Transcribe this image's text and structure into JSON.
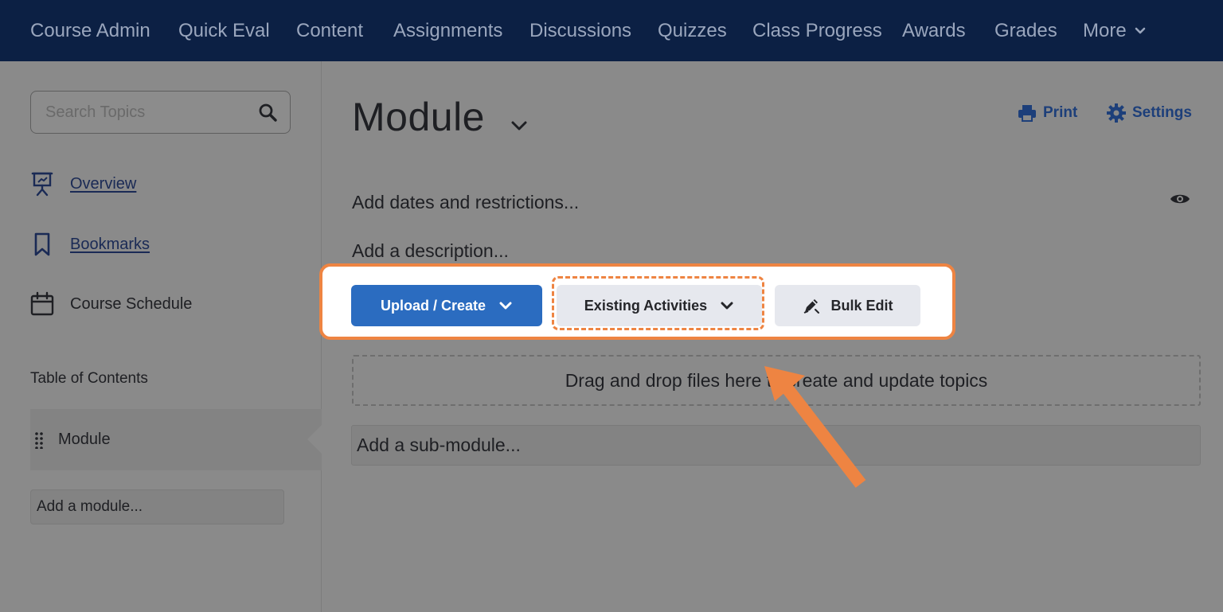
{
  "nav": {
    "items": [
      "Course Admin",
      "Quick Eval",
      "Content",
      "Assignments",
      "Discussions",
      "Quizzes",
      "Class Progress",
      "Awards",
      "Grades"
    ],
    "more_label": "More"
  },
  "sidebar": {
    "search": {
      "placeholder": "Search Topics",
      "value": ""
    },
    "links": {
      "overview": "Overview",
      "bookmarks": "Bookmarks",
      "schedule": "Course Schedule"
    },
    "toc_heading": "Table of Contents",
    "toc_module": "Module",
    "add_module": "Add a module..."
  },
  "main": {
    "title": "Module",
    "print_label": "Print",
    "settings_label": "Settings",
    "dates_text": "Add dates and restrictions...",
    "description_text": "Add a description...",
    "buttons": {
      "upload_create": "Upload / Create",
      "existing_activities": "Existing Activities",
      "bulk_edit": "Bulk Edit"
    },
    "dropzone_text": "Drag and drop files here to create and update topics",
    "submodule_text": "Add a sub-module..."
  },
  "colors": {
    "nav_bg": "#0c2044",
    "overlay_bg": "#8a8a8a",
    "primary_button": "#2b6cc0",
    "highlight": "#ee8442"
  }
}
